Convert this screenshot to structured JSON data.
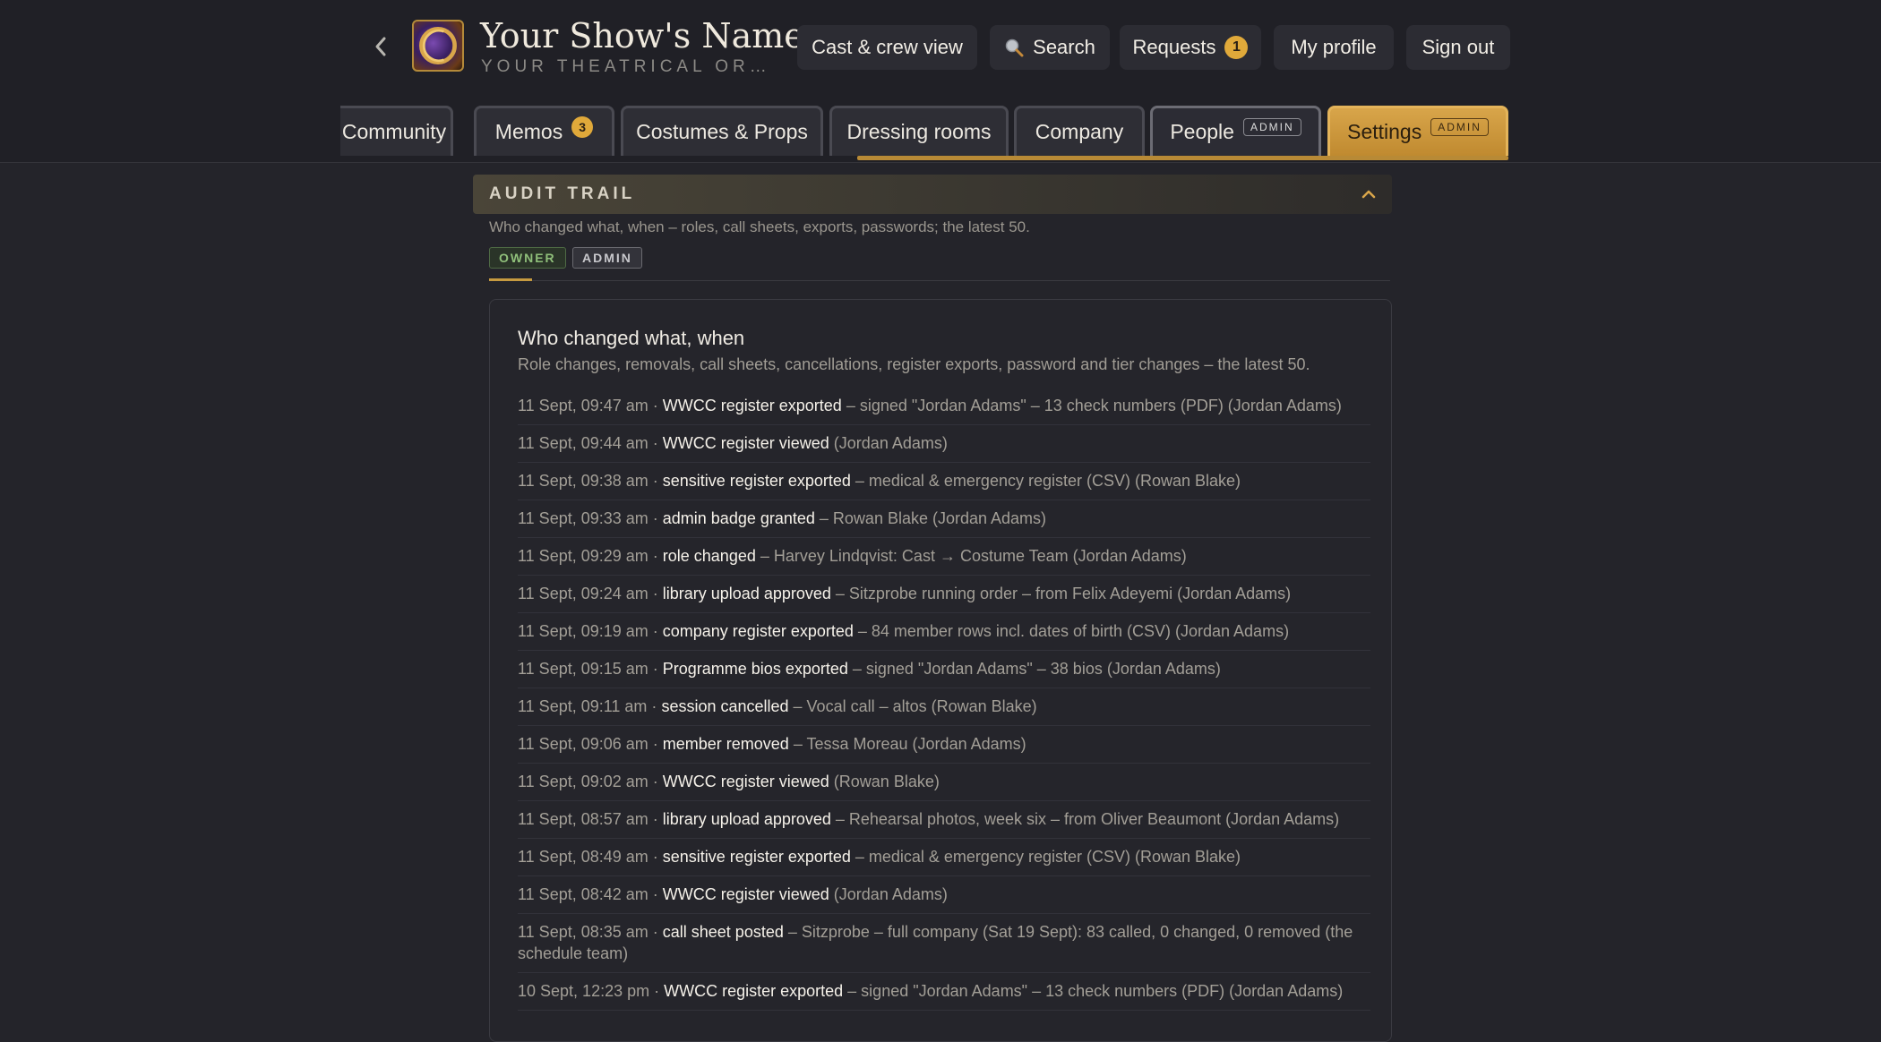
{
  "header": {
    "show_title": "Your Show's Name",
    "org_name": "YOUR THEATRICAL ORGAN...",
    "nav": {
      "cast_view": "Cast & crew view",
      "search": "Search",
      "requests": "Requests",
      "requests_count": "1",
      "profile": "My profile",
      "sign_out": "Sign out"
    }
  },
  "tabs": {
    "community": "Community",
    "memos": "Memos",
    "memos_count": "3",
    "costumes": "Costumes & Props",
    "dressing": "Dressing rooms",
    "company": "Company",
    "people": "People",
    "people_tag": "ADMIN",
    "settings": "Settings",
    "settings_tag": "ADMIN",
    "active": "Settings"
  },
  "section": {
    "title": "AUDIT TRAIL",
    "description": "Who changed what, when – roles, call sheets, exports, passwords; the latest 50.",
    "badge_owner": "OWNER",
    "badge_admin": "ADMIN"
  },
  "card": {
    "title": "Who changed what, when",
    "subtitle": "Role changes, removals, call sheets, cancellations, register exports, password and tier changes – the latest 50."
  },
  "log": [
    {
      "ts": "11 Sept, 09:47 am · ",
      "action": "WWCC register exported",
      "detail": " – signed \"Jordan Adams\" – 13 check numbers (PDF) (Jordan Adams)"
    },
    {
      "ts": "11 Sept, 09:44 am · ",
      "action": "WWCC register viewed",
      "detail": " (Jordan Adams)"
    },
    {
      "ts": "11 Sept, 09:38 am · ",
      "action": "sensitive register exported",
      "detail": " – medical & emergency register (CSV) (Rowan Blake)"
    },
    {
      "ts": "11 Sept, 09:33 am · ",
      "action": "admin badge granted",
      "detail": " – Rowan Blake (Jordan Adams)"
    },
    {
      "ts": "11 Sept, 09:29 am · ",
      "action": "role changed",
      "detail": " – Harvey Lindqvist: Cast → Costume Team (Jordan Adams)"
    },
    {
      "ts": "11 Sept, 09:24 am · ",
      "action": "library upload approved",
      "detail": " – Sitzprobe running order – from Felix Adeyemi (Jordan Adams)"
    },
    {
      "ts": "11 Sept, 09:19 am · ",
      "action": "company register exported",
      "detail": " – 84 member rows incl. dates of birth (CSV) (Jordan Adams)"
    },
    {
      "ts": "11 Sept, 09:15 am · ",
      "action": "Programme bios exported",
      "detail": " – signed \"Jordan Adams\" – 38 bios (Jordan Adams)"
    },
    {
      "ts": "11 Sept, 09:11 am · ",
      "action": "session cancelled",
      "detail": " – Vocal call – altos (Rowan Blake)"
    },
    {
      "ts": "11 Sept, 09:06 am · ",
      "action": "member removed",
      "detail": " – Tessa Moreau (Jordan Adams)"
    },
    {
      "ts": "11 Sept, 09:02 am · ",
      "action": "WWCC register viewed",
      "detail": " (Rowan Blake)"
    },
    {
      "ts": "11 Sept, 08:57 am · ",
      "action": "library upload approved",
      "detail": " – Rehearsal photos, week six – from Oliver Beaumont (Jordan Adams)"
    },
    {
      "ts": "11 Sept, 08:49 am · ",
      "action": "sensitive register exported",
      "detail": " – medical & emergency register (CSV) (Rowan Blake)"
    },
    {
      "ts": "11 Sept, 08:42 am · ",
      "action": "WWCC register viewed",
      "detail": " (Jordan Adams)"
    },
    {
      "ts": "11 Sept, 08:35 am · ",
      "action": "call sheet posted",
      "detail": " – Sitzprobe – full company (Sat 19 Sept): 83 called, 0 changed, 0 removed (the schedule team)"
    },
    {
      "ts": "10 Sept, 12:23 pm · ",
      "action": "WWCC register exported",
      "detail": " – signed \"Jordan Adams\" – 13 check numbers (PDF) (Jordan Adams)"
    }
  ]
}
